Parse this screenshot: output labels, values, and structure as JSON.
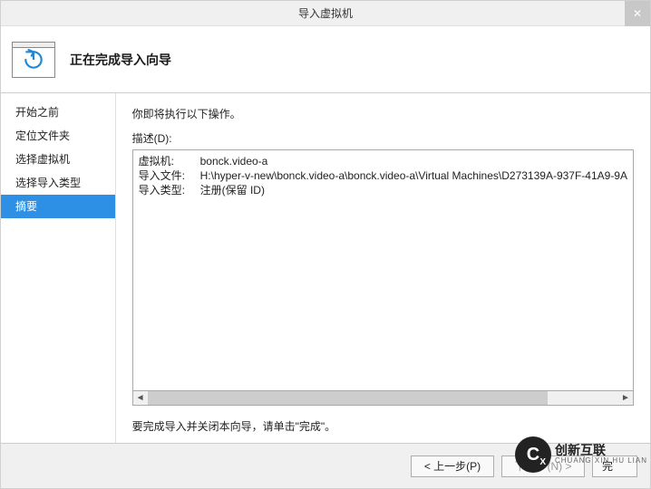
{
  "window": {
    "title": "导入虚拟机",
    "close_glyph": "✕"
  },
  "header": {
    "heading": "正在完成导入向导"
  },
  "sidebar": {
    "steps": [
      {
        "label": "开始之前",
        "active": false
      },
      {
        "label": "定位文件夹",
        "active": false
      },
      {
        "label": "选择虚拟机",
        "active": false
      },
      {
        "label": "选择导入类型",
        "active": false
      },
      {
        "label": "摘要",
        "active": true
      }
    ]
  },
  "content": {
    "intro": "你即将执行以下操作。",
    "desc_label": "描述(D):",
    "summary": {
      "rows": [
        {
          "key": "虚拟机:",
          "value": "bonck.video-a"
        },
        {
          "key": "导入文件:",
          "value": "H:\\hyper-v-new\\bonck.video-a\\bonck.video-a\\Virtual Machines\\D273139A-937F-41A9-9A"
        },
        {
          "key": "导入类型:",
          "value": "注册(保留 ID)"
        }
      ]
    },
    "hint": "要完成导入并关闭本向导，请单击\"完成\"。"
  },
  "footer": {
    "prev": "< 上一步(P)",
    "next": "下一步(N) >",
    "finish": "完",
    "next_disabled": true
  },
  "watermark": {
    "cn": "创新互联",
    "en": "CHUANG XIN HU LIAN"
  }
}
